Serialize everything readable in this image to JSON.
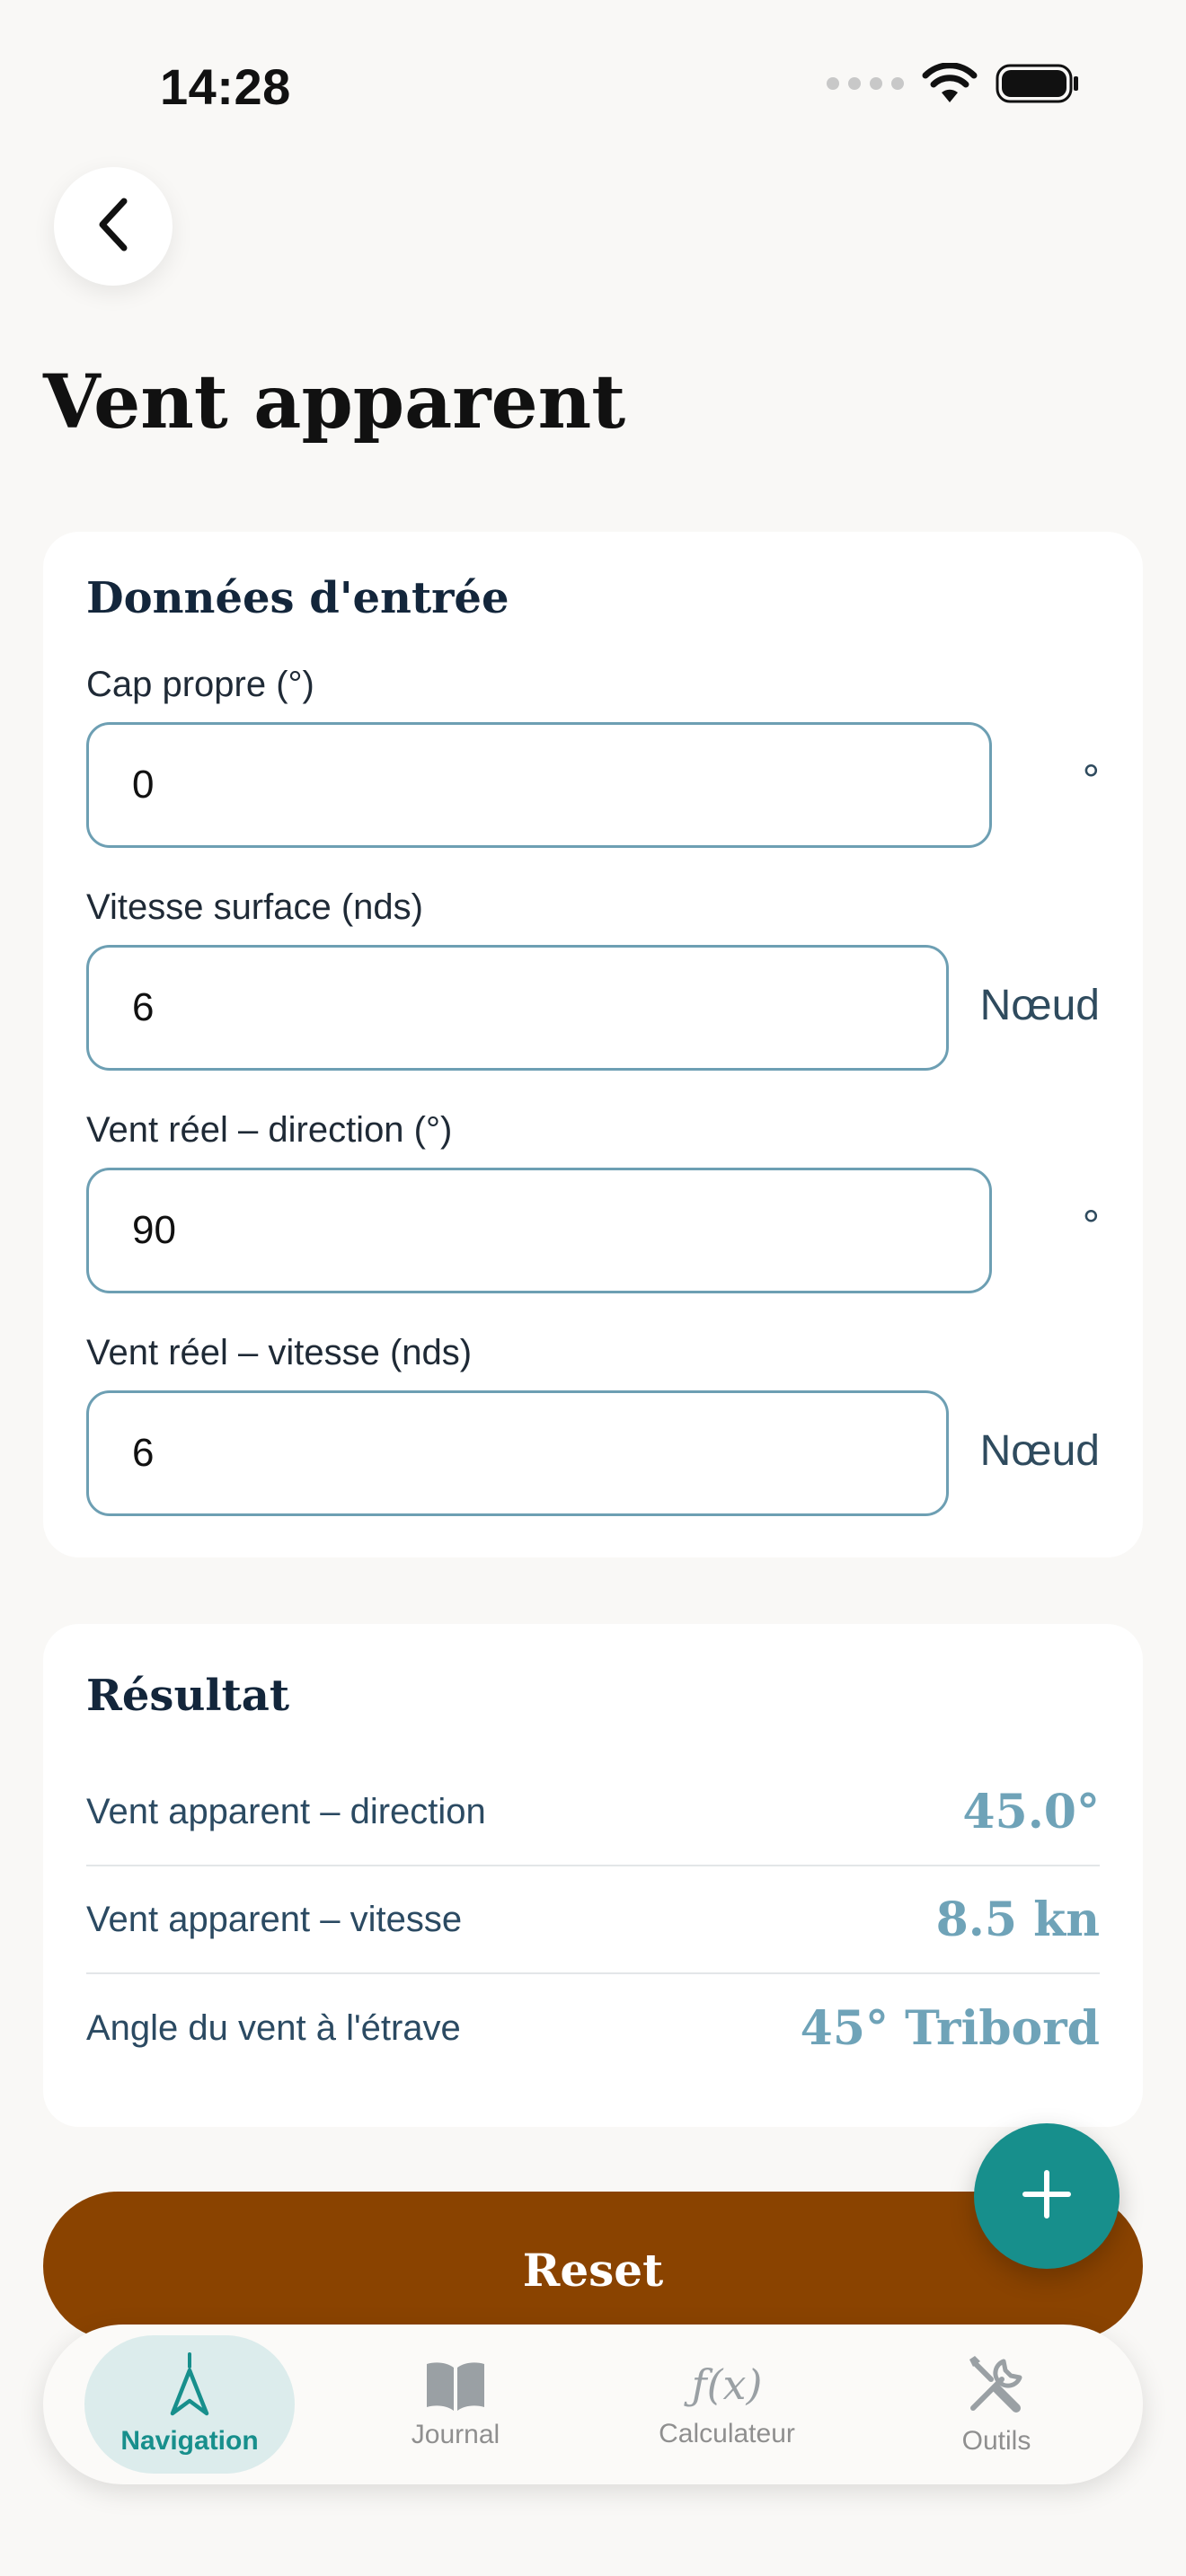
{
  "status_bar": {
    "time": "14:28"
  },
  "page": {
    "title": "Vent apparent"
  },
  "inputs": {
    "title": "Données d'entrée",
    "fields": [
      {
        "label": "Cap propre (°)",
        "value": "0",
        "unit": "°"
      },
      {
        "label": "Vitesse surface (nds)",
        "value": "6",
        "unit": "Nœud"
      },
      {
        "label": "Vent réel – direction (°)",
        "value": "90",
        "unit": "°"
      },
      {
        "label": "Vent réel – vitesse (nds)",
        "value": "6",
        "unit": "Nœud"
      }
    ]
  },
  "results": {
    "title": "Résultat",
    "rows": [
      {
        "label": "Vent apparent – direction",
        "value": "45.0°"
      },
      {
        "label": "Vent apparent – vitesse",
        "value": "8.5 kn"
      },
      {
        "label": "Angle du vent à l'étrave",
        "value": "45° Tribord"
      }
    ]
  },
  "actions": {
    "reset_label": "Reset"
  },
  "tab_bar": {
    "tabs": [
      {
        "label": "Navigation",
        "icon": "navigation-arrow-icon",
        "active": true
      },
      {
        "label": "Journal",
        "icon": "book-icon",
        "active": false
      },
      {
        "label": "Calculateur",
        "icon": "function-icon",
        "active": false
      },
      {
        "label": "Outils",
        "icon": "tools-icon",
        "active": false
      }
    ]
  },
  "colors": {
    "accent_teal": "#178f8c",
    "reset_brown": "#8a4300",
    "result_value": "#6fa3b8",
    "input_border": "#6d9fb3",
    "background": "#f9f8f6"
  }
}
